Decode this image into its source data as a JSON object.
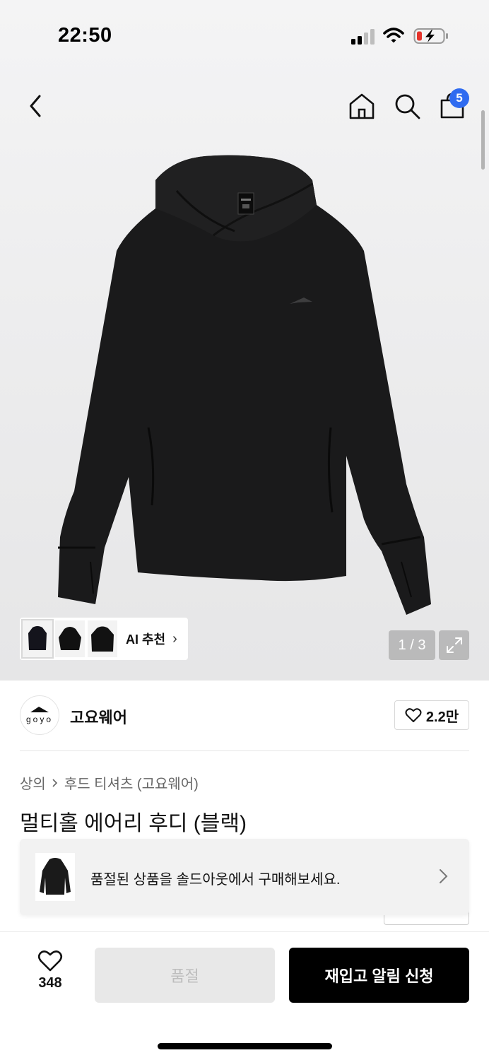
{
  "status_bar": {
    "time": "22:50"
  },
  "nav": {
    "cart_badge": "5"
  },
  "gallery": {
    "pager": "1 / 3",
    "ai_label": "AI 추천"
  },
  "brand": {
    "logo_text": "goyo",
    "name": "고요웨어",
    "likes": "2.2만"
  },
  "breadcrumb": {
    "category": "상의",
    "subcategory": "후드 티셔츠 (고요웨어)"
  },
  "product": {
    "title": "멀티홀 에어리 후디 (블랙)"
  },
  "soldout_banner": {
    "text": "품절된 상품을 솔드아웃에서 구매해보세요."
  },
  "bottom_bar": {
    "wish_count": "348",
    "soldout_label": "품절",
    "restock_label": "재입고 알림 신청"
  },
  "colors": {
    "badge": "#2f6bf0",
    "primary_button": "#000000",
    "disabled_button": "#e8e8e8"
  }
}
